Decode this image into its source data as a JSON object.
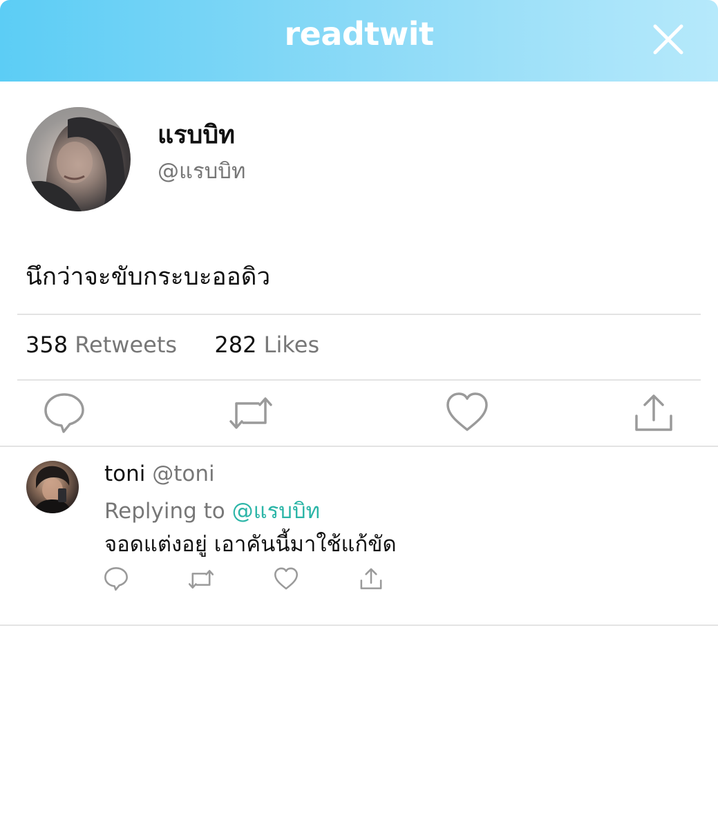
{
  "header": {
    "brand": "readtwit",
    "close_icon": "close-icon"
  },
  "tweet": {
    "display_name": "แรบบิท",
    "handle": "@แรบบิท",
    "text": "นึกว่าจะขับกระบะออดิว",
    "retweets_count": "358",
    "retweets_label": "Retweets",
    "likes_count": "282",
    "likes_label": "Likes",
    "actions": [
      "reply-icon",
      "retweet-icon",
      "like-icon",
      "share-icon"
    ]
  },
  "reply": {
    "name": "toni",
    "handle": "@toni",
    "replying_prefix": "Replying to",
    "replying_to": "@แรบบิท",
    "text": "จอดแต่งอยู่ เอาคันนี้มาใช้แก้ขัด",
    "actions": [
      "reply-icon",
      "retweet-icon",
      "like-icon",
      "share-icon"
    ]
  },
  "colors": {
    "header_start": "#5ccdf5",
    "header_end": "#b6e9fb",
    "mention": "#2bb5a7",
    "muted_text": "#777777",
    "icon_gray": "#9a9a9a"
  }
}
